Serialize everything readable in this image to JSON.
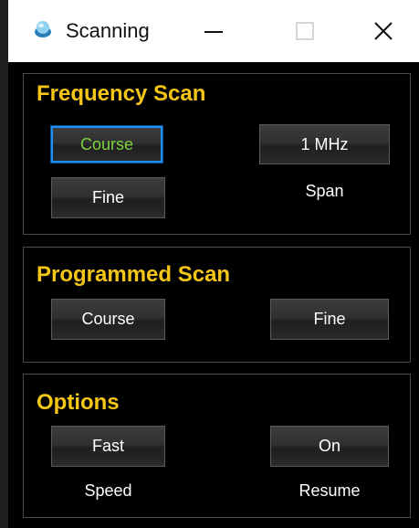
{
  "window": {
    "title": "Scanning",
    "icon": "app-icon",
    "controls": {
      "minimize": "minimize-icon",
      "maximize": "maximize-icon",
      "close": "close-icon"
    }
  },
  "frequency_scan": {
    "title": "Frequency Scan",
    "course_label": "Course",
    "fine_label": "Fine",
    "span_value": "1 MHz",
    "span_caption": "Span",
    "selected": "Course"
  },
  "programmed_scan": {
    "title": "Programmed Scan",
    "course_label": "Course",
    "fine_label": "Fine"
  },
  "options": {
    "title": "Options",
    "speed_value": "Fast",
    "speed_caption": "Speed",
    "resume_value": "On",
    "resume_caption": "Resume"
  },
  "colors": {
    "background": "#000000",
    "group_title": "#f5c518",
    "selected_border": "#1e90ff",
    "selected_text": "#7cd23e",
    "button_text": "#ffffff"
  }
}
